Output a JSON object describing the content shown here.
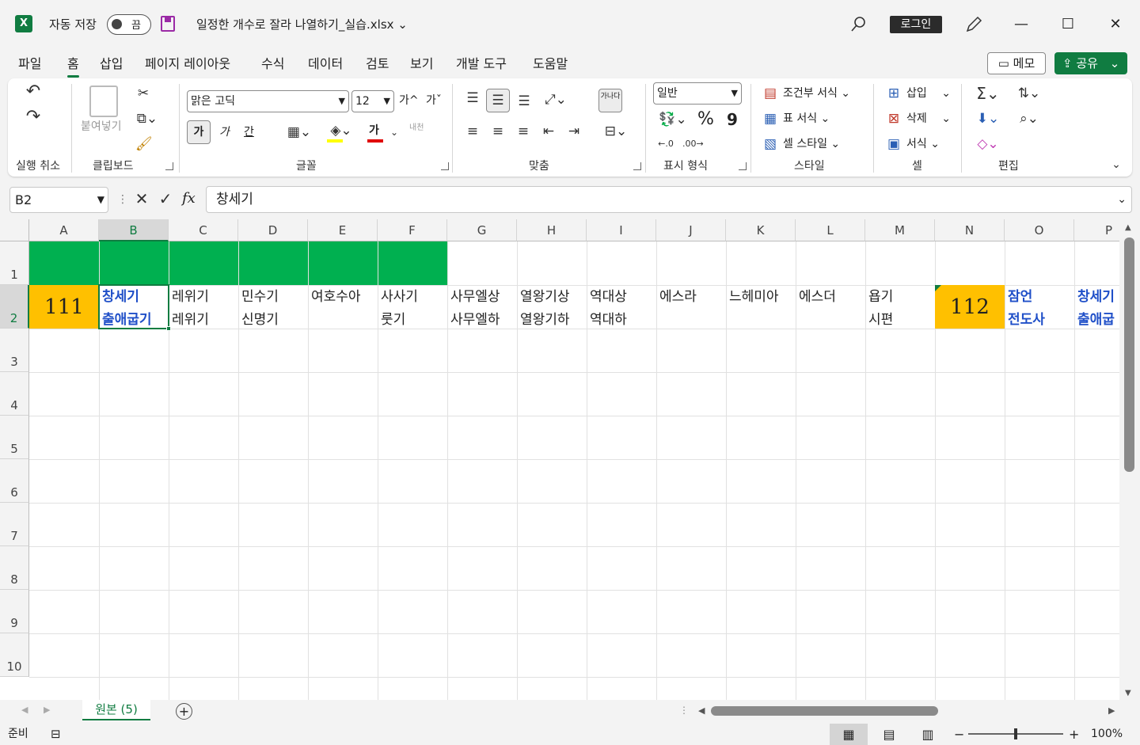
{
  "titlebar": {
    "app_icon": "excel-logo",
    "autosave_label": "자동 저장",
    "autosave_state": "끔",
    "filename": "일정한 개수로 잘라 나열하기_실습.xlsx",
    "filename_chevron": "⌄",
    "search_icon": "search-icon",
    "login_label": "로그인",
    "min_icon": "—",
    "max_icon": "☐",
    "close_icon": "✕"
  },
  "menu": {
    "tabs": [
      "파일",
      "홈",
      "삽입",
      "페이지 레이아웃",
      "수식",
      "데이터",
      "검토",
      "보기",
      "개발 도구",
      "도움말"
    ],
    "active_tab": "홈",
    "memo_label": "메모",
    "share_label": "공유"
  },
  "ribbon": {
    "undo_group": "실행 취소",
    "clipboard_group": "클립보드",
    "paste_label": "붙여넣기",
    "font_group": "글꼴",
    "font_name": "맑은 고딕",
    "font_size": "12",
    "grow_font": "가^",
    "shrink_font": "가ˇ",
    "bold": "가",
    "italic": "가",
    "underline": "간",
    "font_color_glyph": "가",
    "phonetic": "내천",
    "align_group": "맞춤",
    "wrap_glyph": "가나다",
    "number_group": "표시 형식",
    "number_format": "일반",
    "percent": "%",
    "comma": "9",
    "styles_group": "스타일",
    "cond_format": "조건부 서식",
    "table_format": "표 서식",
    "cell_style": "셀 스타일",
    "cells_group": "셀",
    "insert": "삽입",
    "delete": "삭제",
    "format": "서식",
    "editing_group": "편집"
  },
  "formula_bar": {
    "name_box": "B2",
    "fx": "fx",
    "content": "창세기"
  },
  "sheet": {
    "columns": [
      "A",
      "B",
      "C",
      "D",
      "E",
      "F",
      "G",
      "H",
      "I",
      "J",
      "K",
      "L",
      "M",
      "N",
      "O",
      "P"
    ],
    "selected_column": "B",
    "rows": [
      "1",
      "2",
      "3",
      "4",
      "5",
      "6",
      "7",
      "8",
      "9",
      "10"
    ],
    "selected_row": "2",
    "row2": {
      "A": "111",
      "B": "창세기\n출애굽기",
      "C": "레위기\n레위기",
      "D": "민수기\n신명기",
      "E": "여호수아",
      "F": "사사기\n룻기",
      "G": "사무엘상\n사무엘하",
      "H": "열왕기상\n열왕기하",
      "I": "역대상\n역대하",
      "J": "에스라",
      "K": "느헤미아",
      "L": "에스더",
      "M": "욥기\n시편",
      "N": "112",
      "O": "잠언\n전도사",
      "P": "창세기\n출애굽"
    },
    "colors": {
      "header_fill": "#00b050",
      "number_fill": "#ffc000",
      "blue_text": "#1f4fc8"
    }
  },
  "sheet_tabs": {
    "active": "원본 (5)",
    "add_icon": "+"
  },
  "statusbar": {
    "ready": "준비",
    "zoom": "100%",
    "zoom_minus": "−",
    "zoom_plus": "+"
  }
}
